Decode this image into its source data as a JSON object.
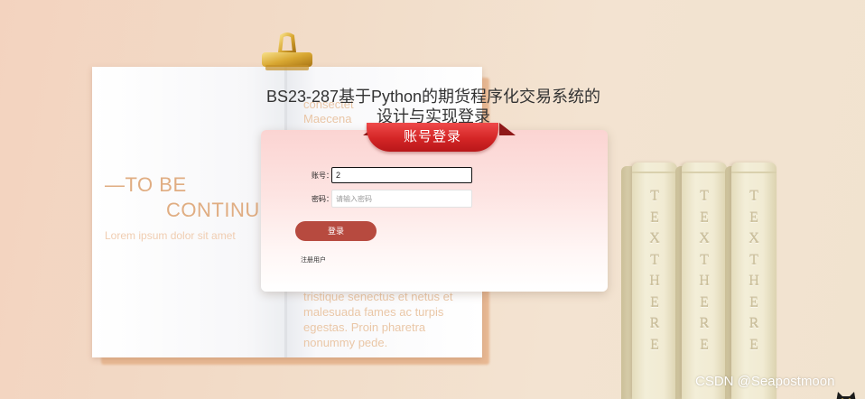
{
  "page": {
    "title": "BS23-287基于Python的期货程序化交易系统的设计与实现登录"
  },
  "background": {
    "book_left_title": "—TO BE",
    "book_left_subtitle": "CONTINU",
    "book_left_lorem": "Lorem ipsum dolor sit amet",
    "book_right_top_line1": "consectet",
    "book_right_top_line2": "Maecena",
    "book_right_bottom_line1": "tristique senectus et netus et",
    "book_right_bottom_line2": "malesuada fames ac turpis",
    "book_right_bottom_line3": "egestas. Proin pharetra",
    "book_right_bottom_line4": "nonummy pede.",
    "book_spines": [
      "TEXTHERE",
      "TEXTHERE",
      "TEXTHERE"
    ]
  },
  "login": {
    "header": "账号登录",
    "username_label": "账号：",
    "username_value": "2",
    "password_label": "密码：",
    "password_placeholder": "请输入密码",
    "login_button": "登录",
    "register_link": "注册用户"
  },
  "watermark": "CSDN @Seapostmoon",
  "icons": {
    "clip": "binder-clip-icon",
    "corner": "cat-icon"
  },
  "colors": {
    "ribbon": "#d42526",
    "login_button": "#b74a3f",
    "accent_text": "#e0ad82"
  }
}
